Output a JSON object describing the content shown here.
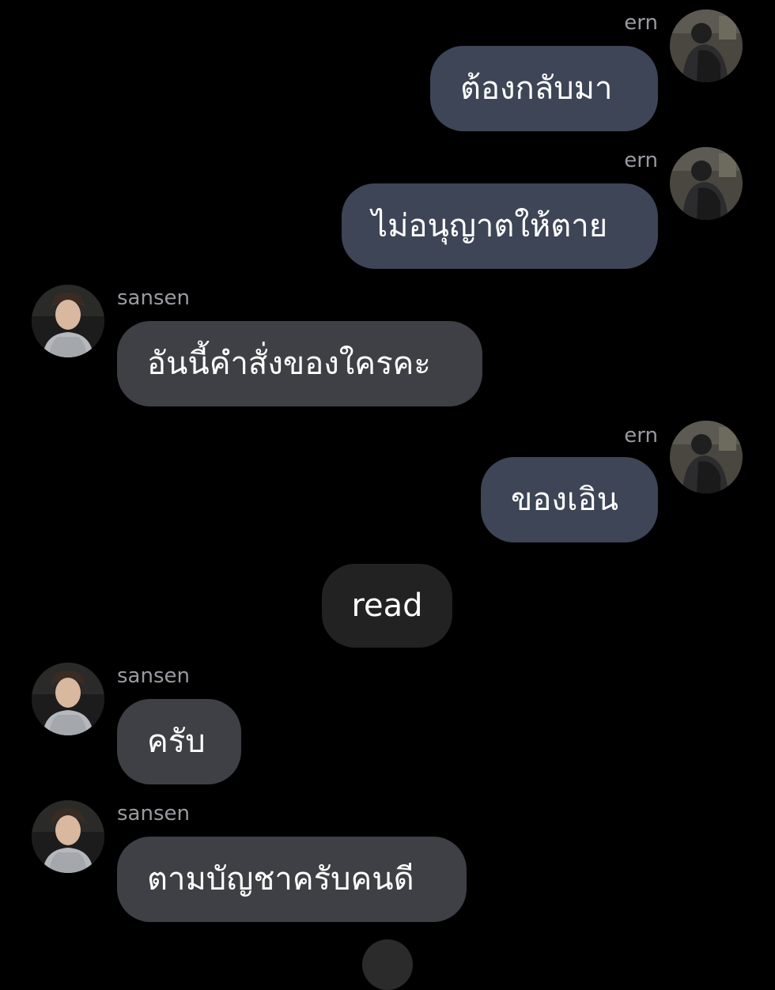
{
  "theme": {
    "background": "#000000",
    "outgoing_bubble": "#3d4556",
    "incoming_bubble": "#3f4045",
    "status_pill": "#222222",
    "name_color": "#9a9aa0",
    "text_color": "#ffffff"
  },
  "messages": [
    {
      "sender": "ern",
      "direction": "outgoing",
      "avatar": "ern-avatar",
      "text": "ต้องกลับมา"
    },
    {
      "sender": "ern",
      "direction": "outgoing",
      "avatar": "ern-avatar",
      "text": "ไม่อนุญาตให้ตาย"
    },
    {
      "sender": "sansen",
      "direction": "incoming",
      "avatar": "sansen-avatar",
      "text": "อันนี้คำสั่งของใครคะ"
    },
    {
      "sender": "ern",
      "direction": "outgoing",
      "avatar": "ern-avatar",
      "text": "ของเอิน"
    },
    {
      "sender": "sansen",
      "direction": "incoming",
      "avatar": "sansen-avatar",
      "text": "ครับ"
    },
    {
      "sender": "sansen",
      "direction": "incoming",
      "avatar": "sansen-avatar",
      "text": "ตามบัญชาครับคนดี"
    }
  ],
  "status": {
    "label": "read"
  }
}
